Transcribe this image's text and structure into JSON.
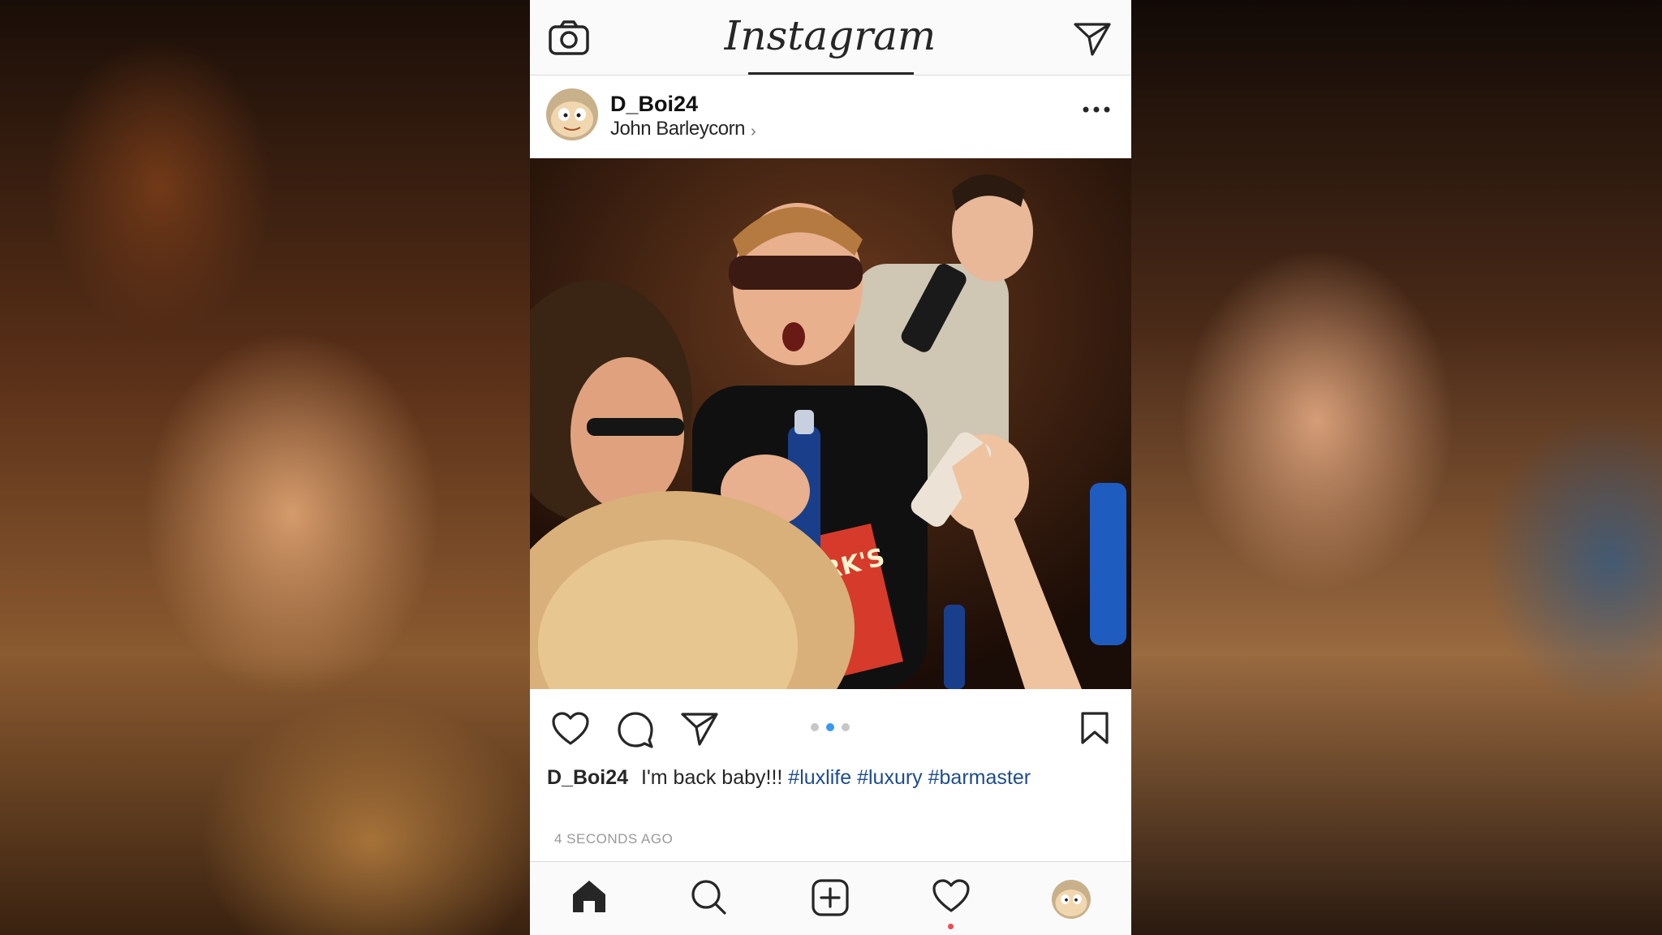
{
  "app": {
    "name": "Instagram"
  },
  "post": {
    "username": "D_Boi24",
    "location": "John Barleycorn",
    "caption_user": "D_Boi24",
    "caption_text": "I'm back baby!!!",
    "hashtags": [
      "#luxlife",
      "#luxury",
      "#barmaster"
    ],
    "timestamp": "4 SECONDS AGO",
    "carousel": {
      "count": 3,
      "active_index": 1
    }
  },
  "colors": {
    "hashtag": "#1f4c8c",
    "carousel_active": "#3897f0",
    "notification": "#ed4956"
  },
  "icons": {
    "topbar": [
      "camera-icon",
      "direct-message-icon"
    ],
    "actions": [
      "heart-icon",
      "comment-icon",
      "share-icon",
      "bookmark-icon"
    ],
    "tabs": [
      "home-icon",
      "search-icon",
      "add-post-icon",
      "activity-heart-icon",
      "profile-avatar"
    ]
  }
}
